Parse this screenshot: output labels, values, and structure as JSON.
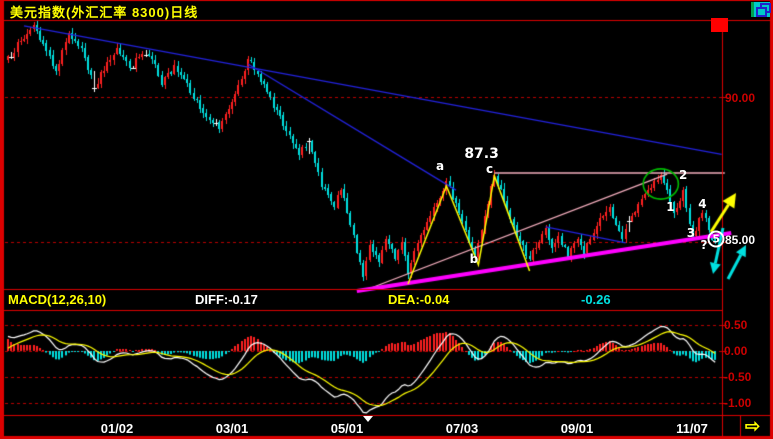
{
  "window": {
    "title": "美元指数(外汇汇率 8300)日线"
  },
  "ui": {
    "scroll_right_glyph": "⇨"
  },
  "colors": {
    "background": "#000000",
    "up_candle": "#ff2020",
    "down_candle": "#00e0e0",
    "doji": "#ffffff",
    "grid": "#b80000",
    "border": "#dd0000",
    "diff_line": "#ffffff",
    "dea_line": "#ffff00",
    "hist_positive": "#ff2020",
    "hist_negative": "#00e0e0"
  },
  "chart_data": {
    "type": "candlestick",
    "title": "美元指数(外汇汇率 8300)日线",
    "symbol": "美元指数",
    "market": "外汇汇率 8300",
    "period": "日线",
    "y_axis": {
      "label_90": "90.00",
      "current_price_label": "85.00",
      "gridline_values": [
        90.0,
        85.0
      ]
    },
    "x_axis": {
      "labels": [
        "01/02",
        "03/01",
        "05/01",
        "07/03",
        "09/01",
        "11/07"
      ],
      "label_days": [
        34,
        70,
        106,
        142,
        178,
        214
      ]
    },
    "days_total": 222,
    "price_anchors": [
      [
        0,
        91.4
      ],
      [
        5,
        92.0
      ],
      [
        8,
        92.5
      ],
      [
        12,
        91.6
      ],
      [
        15,
        90.9
      ],
      [
        19,
        92.2
      ],
      [
        23,
        91.7
      ],
      [
        27,
        90.3
      ],
      [
        31,
        91.2
      ],
      [
        34,
        91.7
      ],
      [
        38,
        91.0
      ],
      [
        42,
        91.5
      ],
      [
        45,
        91.3
      ],
      [
        48,
        90.4
      ],
      [
        52,
        91.1
      ],
      [
        56,
        90.5
      ],
      [
        60,
        89.6
      ],
      [
        63,
        89.2
      ],
      [
        66,
        88.9
      ],
      [
        69,
        89.6
      ],
      [
        72,
        90.4
      ],
      [
        75,
        91.3
      ],
      [
        78,
        90.8
      ],
      [
        82,
        90.0
      ],
      [
        86,
        89.0
      ],
      [
        89,
        88.4
      ],
      [
        91,
        88.0
      ],
      [
        94,
        88.5
      ],
      [
        98,
        86.9
      ],
      [
        102,
        86.2
      ],
      [
        104,
        86.8
      ],
      [
        107,
        85.6
      ],
      [
        110,
        84.3
      ],
      [
        111,
        83.8
      ],
      [
        113,
        84.9
      ],
      [
        116,
        84.3
      ],
      [
        118,
        85.1
      ],
      [
        121,
        84.4
      ],
      [
        123,
        85.0
      ],
      [
        125,
        83.9
      ],
      [
        127,
        84.7
      ],
      [
        130,
        85.4
      ],
      [
        133,
        86.2
      ],
      [
        137,
        87.1
      ],
      [
        139,
        86.5
      ],
      [
        141,
        86.0
      ],
      [
        143,
        85.4
      ],
      [
        146,
        84.5
      ],
      [
        148,
        85.4
      ],
      [
        150,
        86.3
      ],
      [
        152,
        87.3
      ],
      [
        155,
        86.4
      ],
      [
        157,
        85.8
      ],
      [
        159,
        85.2
      ],
      [
        163,
        84.4
      ],
      [
        166,
        85.0
      ],
      [
        168,
        85.5
      ],
      [
        170,
        84.8
      ],
      [
        172,
        85.2
      ],
      [
        175,
        84.5
      ],
      [
        178,
        85.1
      ],
      [
        180,
        84.6
      ],
      [
        183,
        85.3
      ],
      [
        186,
        85.9
      ],
      [
        188,
        86.2
      ],
      [
        190,
        85.6
      ],
      [
        192,
        85.1
      ],
      [
        195,
        85.9
      ],
      [
        198,
        86.5
      ],
      [
        202,
        87.1
      ],
      [
        204,
        87.3
      ],
      [
        206,
        86.8
      ],
      [
        208,
        86.0
      ],
      [
        211,
        86.8
      ],
      [
        214,
        85.2
      ],
      [
        217,
        86.0
      ],
      [
        219,
        85.4
      ],
      [
        221,
        85.0
      ]
    ],
    "doji_days": [
      27,
      94,
      194
    ],
    "trendlines": [
      {
        "name": "major-descending-trendline",
        "color": "#2323e0",
        "width": 1.3,
        "points": [
          [
            5,
            92.45
          ],
          [
            223,
            88.02
          ]
        ]
      },
      {
        "name": "secondary-descending-trendline",
        "color": "#2323e0",
        "width": 1.3,
        "points": [
          [
            75,
            91.14
          ],
          [
            140,
            86.79
          ]
        ]
      },
      {
        "name": "minor-descending-trendline",
        "color": "#2323e0",
        "width": 1.3,
        "points": [
          [
            168,
            85.52
          ],
          [
            193,
            84.97
          ]
        ]
      },
      {
        "name": "resistance-horizontal-line",
        "color": "#f5aebe",
        "width": 1.3,
        "points": [
          [
            152,
            87.38
          ],
          [
            224,
            87.38
          ]
        ]
      },
      {
        "name": "ascending-channel-line",
        "color": "#f5aebe",
        "width": 1.3,
        "points": [
          [
            111,
            83.31
          ],
          [
            206,
            87.34
          ]
        ]
      },
      {
        "name": "support-trendline-thick",
        "color": "#ff00ff",
        "width": 4,
        "points": [
          [
            109,
            83.31
          ],
          [
            226,
            85.31
          ]
        ]
      },
      {
        "name": "abc-zigzag-line",
        "color": "#ffff00",
        "width": 1.5,
        "points": [
          [
            125,
            83.55
          ],
          [
            137,
            86.93
          ],
          [
            147,
            84.21
          ],
          [
            152,
            87.28
          ],
          [
            163,
            84.0
          ]
        ]
      }
    ],
    "ellipse": {
      "name": "top-highlight-ellipse",
      "color": "#00bb00",
      "day": 204,
      "price": 87.0,
      "rx_days": 5.5,
      "ry_price": 0.52
    },
    "annotations": [
      {
        "name": "wave-label-a",
        "text": "a",
        "day": 135,
        "price": 87.62
      },
      {
        "name": "price-peak-label",
        "text": "87.3",
        "day": 148,
        "price": 88.02,
        "big": true
      },
      {
        "name": "wave-label-c",
        "text": "c",
        "day": 150.5,
        "price": 87.52
      },
      {
        "name": "wave-label-b",
        "text": "b",
        "day": 145.6,
        "price": 84.42
      },
      {
        "name": "wave-label-1",
        "text": "1",
        "day": 207,
        "price": 86.22
      },
      {
        "name": "wave-label-2",
        "text": "2",
        "day": 211,
        "price": 87.32
      },
      {
        "name": "wave-label-3",
        "text": "3",
        "day": 213.4,
        "price": 85.32
      },
      {
        "name": "wave-label-4",
        "text": "4",
        "day": 217,
        "price": 86.32
      },
      {
        "name": "wave-label-5",
        "text": "5",
        "day": 221.3,
        "price": 85.1,
        "circled": true
      },
      {
        "name": "question-mark-label",
        "text": "?",
        "day": 217.5,
        "price": 84.88
      }
    ],
    "arrows": [
      {
        "name": "bullish-projection-arrow",
        "color": "#ffff00",
        "width": 3,
        "head": 14,
        "from": [
          711,
          232
        ],
        "to": [
          736,
          193
        ]
      },
      {
        "name": "bearish-scenario-arrow",
        "color": "#00e0e0",
        "width": 3,
        "head": 11,
        "from": [
          723,
          228
        ],
        "to": [
          713,
          274
        ]
      },
      {
        "name": "alternative-bullish-arrow",
        "color": "#00e0e0",
        "width": 3,
        "head": 11,
        "from": [
          728,
          279
        ],
        "to": [
          746,
          245
        ]
      }
    ],
    "macd": {
      "params_label": "MACD(12,26,10)",
      "diff_label": "DIFF:-0.17",
      "dea_label": "DEA:-0.04",
      "hist_label": "-0.26",
      "diff": -0.17,
      "dea": -0.04,
      "hist": -0.26,
      "axis_labels": [
        "0.50",
        "0.00",
        "-0.50",
        "-1.00"
      ],
      "axis_values": [
        0.5,
        0.0,
        -0.5,
        -1.0
      ]
    }
  }
}
